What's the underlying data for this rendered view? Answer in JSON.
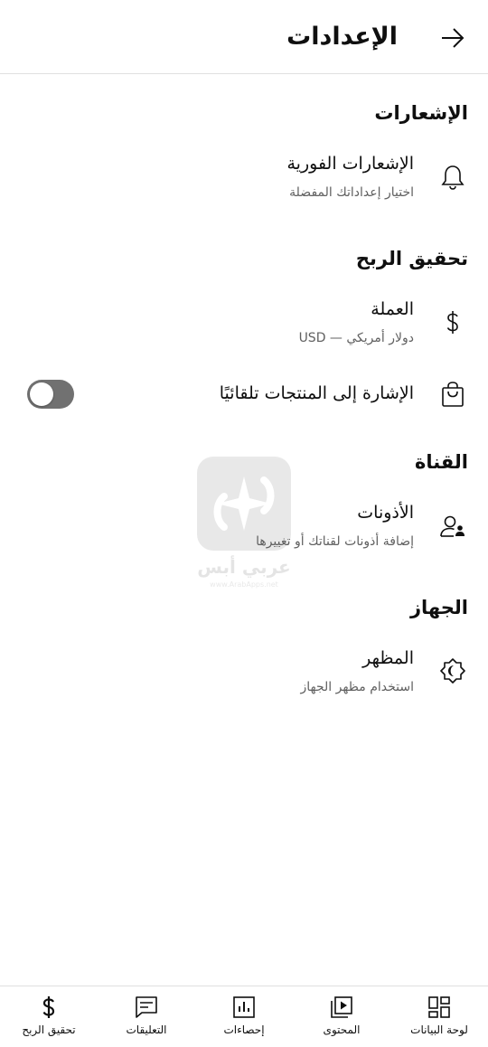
{
  "header": {
    "title": "الإعدادات",
    "back_icon": "arrow-right-icon"
  },
  "sections": {
    "notifications": {
      "title": "الإشعارات",
      "push": {
        "title": "الإشعارات الفورية",
        "subtitle": "اختيار إعداداتك المفضلة",
        "icon": "bell-icon"
      }
    },
    "monetization": {
      "title": "تحقيق الربح",
      "currency": {
        "title": "العملة",
        "subtitle": "دولار أمريكي — USD",
        "icon": "dollar-icon"
      },
      "product_tagging": {
        "title": "الإشارة إلى المنتجات تلقائيًا",
        "icon": "shopping-bag-icon",
        "toggle_on": false
      }
    },
    "channel": {
      "title": "القناة",
      "permissions": {
        "title": "الأذونات",
        "subtitle": "إضافة أذونات لقناتك أو تغييرها",
        "icon": "person-add-icon"
      }
    },
    "device": {
      "title": "الجهاز",
      "appearance": {
        "title": "المظهر",
        "subtitle": "استخدام مظهر الجهاز",
        "icon": "brightness-icon"
      }
    }
  },
  "watermark": {
    "text": "عربي أبس",
    "url": "www.ArabApps.net"
  },
  "bottom_nav": [
    {
      "label": "لوحة البيانات",
      "icon": "dashboard-icon"
    },
    {
      "label": "المحتوى",
      "icon": "video-library-icon"
    },
    {
      "label": "إحصاءات",
      "icon": "analytics-icon"
    },
    {
      "label": "التعليقات",
      "icon": "comments-icon"
    },
    {
      "label": "تحقيق الربح",
      "icon": "dollar-icon"
    }
  ],
  "colors": {
    "text": "#0f0f0f",
    "secondary_text": "#606060",
    "divider": "#e0e0e0",
    "toggle_off": "#717171"
  }
}
